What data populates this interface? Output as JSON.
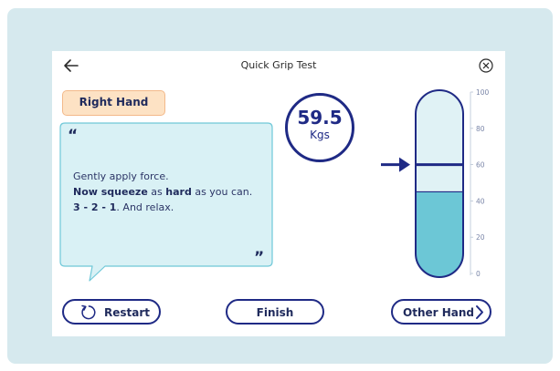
{
  "header": {
    "title": "Quick Grip Test"
  },
  "hand_label": "Right Hand",
  "instructions": {
    "quote_open": "“",
    "quote_close": "”",
    "line1": "Gently apply force.",
    "line2_bold1": "Now squeeze",
    "line2_mid": " as ",
    "line2_bold2": "hard",
    "line2_end": " as you can.",
    "line3_bold": "3 - 2 - 1",
    "line3_end": ".  And relax."
  },
  "reading": {
    "value": "59.5",
    "unit": "Kgs"
  },
  "gauge": {
    "scale_labels": [
      "100",
      "80",
      "60",
      "40",
      "20",
      "0"
    ],
    "fill_level": 45,
    "target_level": 60,
    "colors": {
      "fill": "#6cc7d6",
      "empty": "#e0f2f5",
      "outline": "#1f2a85",
      "marker": "#1f2a85"
    }
  },
  "buttons": {
    "restart": "Restart",
    "finish": "Finish",
    "other_hand": "Other Hand"
  },
  "colors": {
    "accent": "#1f2a85",
    "panel": "#d6e9ee",
    "bubble": "#d9f1f5",
    "badge": "#fde2c4"
  }
}
